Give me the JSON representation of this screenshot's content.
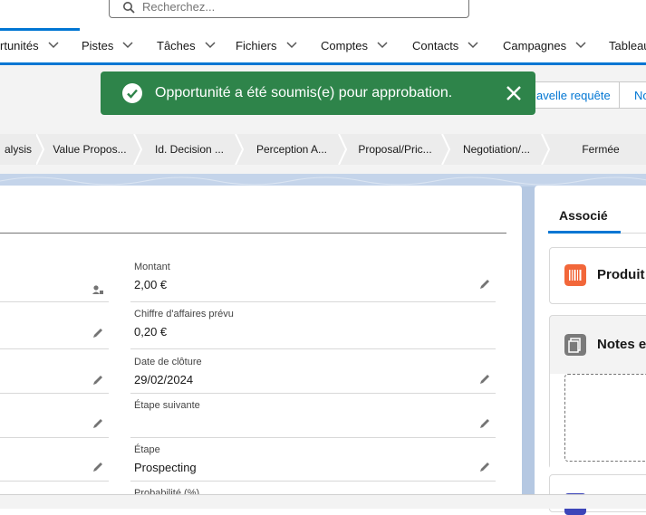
{
  "search": {
    "placeholder": "Recherchez..."
  },
  "nav": {
    "items": [
      {
        "label": "rtunités"
      },
      {
        "label": "Pistes"
      },
      {
        "label": "Tâches"
      },
      {
        "label": "Fichiers"
      },
      {
        "label": "Comptes"
      },
      {
        "label": "Contacts"
      },
      {
        "label": "Campagnes"
      },
      {
        "label": "Tableau"
      }
    ]
  },
  "toast": {
    "message": "Opportunité a été soumis(e) pour approbation."
  },
  "header_buttons": {
    "request": "avelle requête",
    "other": "No"
  },
  "path": {
    "steps": [
      "alysis",
      "Value Propos...",
      "Id. Decision ...",
      "Perception A...",
      "Proposal/Pric...",
      "Negotiation/...",
      "Fermée"
    ]
  },
  "fields": {
    "montant": {
      "label": "Montant",
      "value": "2,00 €"
    },
    "chiffre": {
      "label": "Chiffre d'affaires prévu",
      "value": "0,20 €"
    },
    "cloture": {
      "label": "Date de clôture",
      "value": "29/02/2024"
    },
    "etape_suivante": {
      "label": "Étape suivante",
      "value": ""
    },
    "etape": {
      "label": "Étape",
      "value": "Prospecting"
    },
    "probabilite": {
      "label": "Probabilité (%)"
    }
  },
  "right_panel": {
    "tab": "Associé",
    "cards": [
      {
        "title": "Produit",
        "icon": "barcode-icon"
      },
      {
        "title": "Notes e",
        "icon": "notes-icon"
      }
    ]
  },
  "colors": {
    "brand": "#0176d3",
    "toast": "#2e844a",
    "products_icon": "#f2673a",
    "notes_icon": "#7a7a7a"
  }
}
